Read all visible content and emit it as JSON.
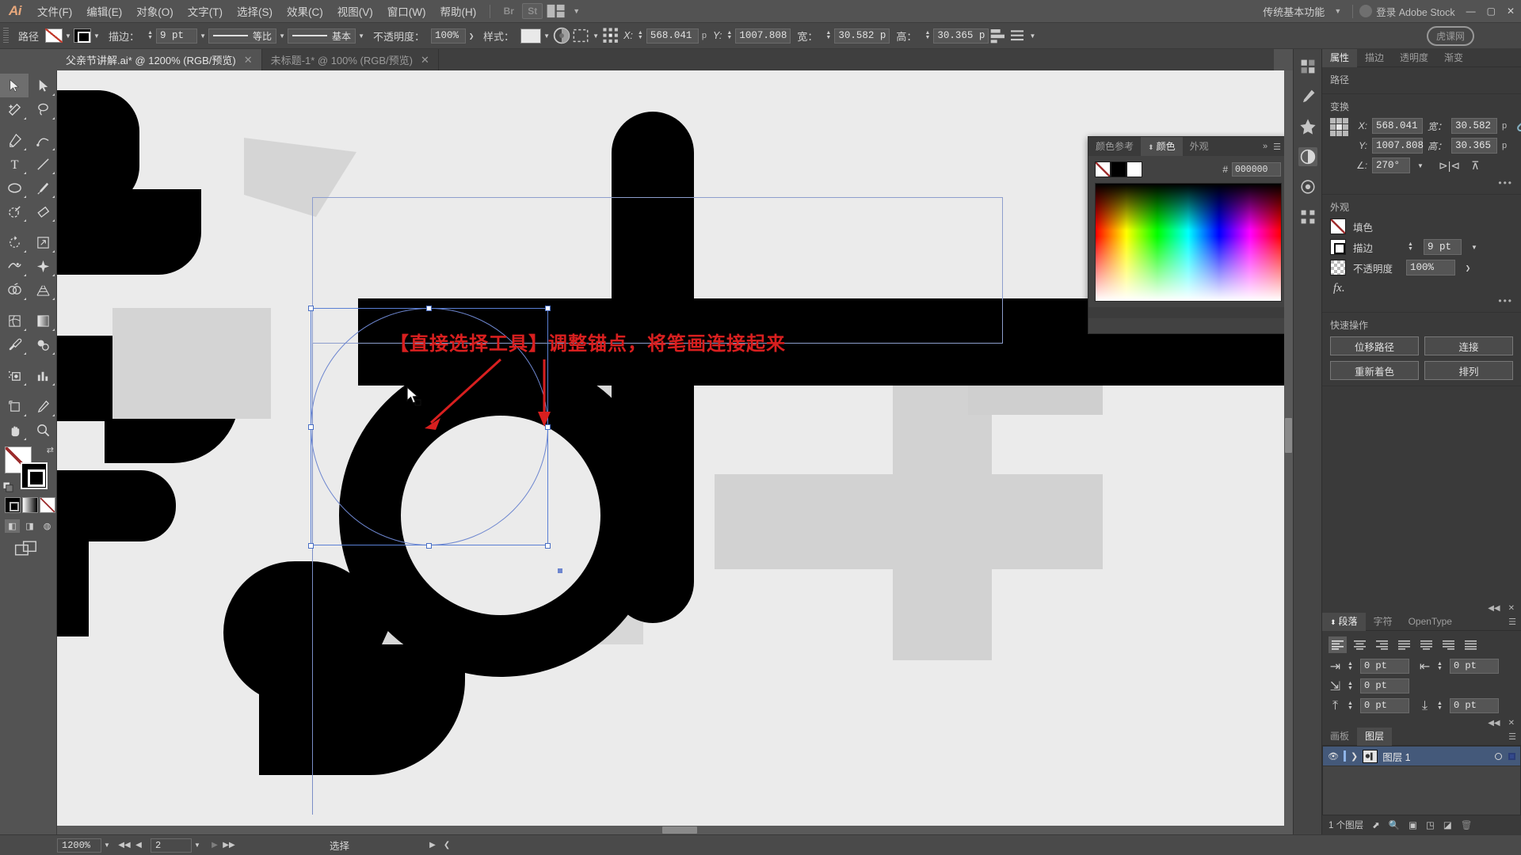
{
  "app": {
    "name": "Ai",
    "title": "Adobe Illustrator"
  },
  "menubar": {
    "items": [
      {
        "label": "文件(F)",
        "name": "menu-file"
      },
      {
        "label": "编辑(E)",
        "name": "menu-edit"
      },
      {
        "label": "对象(O)",
        "name": "menu-object"
      },
      {
        "label": "文字(T)",
        "name": "menu-type"
      },
      {
        "label": "选择(S)",
        "name": "menu-select"
      },
      {
        "label": "效果(C)",
        "name": "menu-effect"
      },
      {
        "label": "视图(V)",
        "name": "menu-view"
      },
      {
        "label": "窗口(W)",
        "name": "menu-window"
      },
      {
        "label": "帮助(H)",
        "name": "menu-help"
      }
    ],
    "bridge_label": "Br",
    "stock_label": "St",
    "arrange_label": "",
    "workspace": "传统基本功能",
    "signin": "登录 Adobe Stock",
    "win_min": "—",
    "win_max": "▢",
    "win_close": "✕"
  },
  "controlbar": {
    "object_label": "路径",
    "stroke_label": "描边：",
    "stroke_weight": "9 pt",
    "stroke_profile": "等比",
    "brush_def": "基本",
    "opacity_label": "不透明度：",
    "opacity_value": "100%",
    "style_label": "样式：",
    "x_label": "X:",
    "x_value": "568.041",
    "x_unit": "p",
    "y_label": "Y:",
    "y_value": "1007.808",
    "w_label": "宽：",
    "w_value": "30.582 p",
    "h_label": "高：",
    "h_value": "30.365 p"
  },
  "tabs": [
    {
      "title": "父亲节讲解.ai* @ 1200% (RGB/预览)",
      "active": true,
      "close": "✕"
    },
    {
      "title": "未标题-1* @ 100% (RGB/预览)",
      "active": false,
      "close": "✕"
    }
  ],
  "toolbar": {
    "tools": [
      {
        "name": "selection-tool",
        "glyph": "selection",
        "selected": true
      },
      {
        "name": "direct-selection-tool",
        "glyph": "direct"
      },
      {
        "name": "magic-wand-tool",
        "glyph": "wand"
      },
      {
        "name": "lasso-tool",
        "glyph": "lasso"
      },
      {
        "name": "pen-tool",
        "glyph": "pen"
      },
      {
        "name": "curvature-tool",
        "glyph": "curv"
      },
      {
        "name": "type-tool",
        "glyph": "type"
      },
      {
        "name": "line-segment-tool",
        "glyph": "line"
      },
      {
        "name": "ellipse-tool",
        "glyph": "ellipse"
      },
      {
        "name": "paintbrush-tool",
        "glyph": "brush"
      },
      {
        "name": "shaper-tool",
        "glyph": "shaper"
      },
      {
        "name": "eraser-tool",
        "glyph": "eraser"
      },
      {
        "name": "rotate-tool",
        "glyph": "rotate"
      },
      {
        "name": "scale-tool",
        "glyph": "scale"
      },
      {
        "name": "width-tool",
        "glyph": "width"
      },
      {
        "name": "free-transform-tool",
        "glyph": "freetr"
      },
      {
        "name": "shape-builder-tool",
        "glyph": "shapebuild"
      },
      {
        "name": "perspective-grid-tool",
        "glyph": "persp"
      },
      {
        "name": "mesh-tool",
        "glyph": "mesh"
      },
      {
        "name": "gradient-tool",
        "glyph": "gradient"
      },
      {
        "name": "eyedropper-tool",
        "glyph": "eyedrop"
      },
      {
        "name": "blend-tool",
        "glyph": "blend"
      },
      {
        "name": "symbol-sprayer-tool",
        "glyph": "symbol"
      },
      {
        "name": "column-graph-tool",
        "glyph": "graph"
      },
      {
        "name": "artboard-tool",
        "glyph": "artboard"
      },
      {
        "name": "slice-tool",
        "glyph": "slice"
      },
      {
        "name": "hand-tool",
        "glyph": "hand"
      },
      {
        "name": "zoom-tool",
        "glyph": "zoom"
      }
    ],
    "fill_color": "#ffffff",
    "stroke_color": "#000000"
  },
  "canvas": {
    "annotation": "【直接选择工具】调整锚点，将笔画连接起来",
    "annotation_color": "#d81f1f",
    "artwork_alt": "大写字母 d 形黑色字体轮廓"
  },
  "color_panel": {
    "tabs": [
      {
        "label": "颜色参考",
        "active": false,
        "name": "tab-color-guide"
      },
      {
        "label": "颜色",
        "active": true,
        "name": "tab-color"
      },
      {
        "label": "外观",
        "active": false,
        "name": "tab-appearance"
      }
    ],
    "expand": "»",
    "menu": "☰",
    "hex_label": "#",
    "hex_value": "000000",
    "swatch_none": "none",
    "swatch_black": "#000000",
    "swatch_white": "#ffffff"
  },
  "properties": {
    "tabs": [
      {
        "label": "属性",
        "active": true,
        "name": "tab-properties"
      },
      {
        "label": "描边",
        "active": false,
        "name": "tab-stroke"
      },
      {
        "label": "透明度",
        "active": false,
        "name": "tab-transparency"
      },
      {
        "label": "渐变",
        "active": false,
        "name": "tab-gradient"
      }
    ],
    "object_type": "路径",
    "transform": {
      "title": "变换",
      "x_label": "X:",
      "x_value": "568.041",
      "y_label": "Y:",
      "y_value": "1007.808",
      "w_label": "宽：",
      "w_value": "30.582",
      "w_unit": "p",
      "h_label": "高：",
      "h_value": "30.365",
      "h_unit": "p",
      "angle_label": "∠:",
      "angle_value": "270°",
      "more": "•••"
    },
    "appearance": {
      "title": "外观",
      "fill_label": "填色",
      "stroke_label": "描边",
      "stroke_value": "9 pt",
      "opacity_label": "不透明度",
      "opacity_value": "100%",
      "fx_label": "fx.",
      "more": "•••"
    },
    "quick_actions": {
      "title": "快速操作",
      "buttons": [
        {
          "label": "位移路径",
          "name": "offset-path-button"
        },
        {
          "label": "连接",
          "name": "join-button"
        },
        {
          "label": "重新着色",
          "name": "recolor-button"
        },
        {
          "label": "排列",
          "name": "arrange-button"
        }
      ]
    }
  },
  "paragraph_panel": {
    "tabs": [
      {
        "label": "段落",
        "active": true,
        "name": "tab-paragraph"
      },
      {
        "label": "字符",
        "active": false,
        "name": "tab-character"
      },
      {
        "label": "OpenType",
        "active": false,
        "name": "tab-opentype"
      }
    ],
    "menu": "☰",
    "collapse": "◀◀",
    "close": "✕",
    "indents": [
      {
        "name": "left-indent",
        "value": "0 pt"
      },
      {
        "name": "right-indent",
        "value": "0 pt"
      },
      {
        "name": "first-line-indent",
        "value": "0 pt"
      },
      {
        "name": "space-before",
        "value": "0 pt"
      },
      {
        "name": "space-after",
        "value": "0 pt"
      }
    ]
  },
  "layers_panel": {
    "tabs": [
      {
        "label": "画板",
        "active": false,
        "name": "tab-artboards"
      },
      {
        "label": "图层",
        "active": true,
        "name": "tab-layers"
      }
    ],
    "menu": "☰",
    "collapse": "◀◀",
    "close": "✕",
    "rows": [
      {
        "name": "图层 1",
        "visible": true,
        "selected": true
      }
    ],
    "footer_count": "1 个图层",
    "footer_icons": [
      "locate-object-icon",
      "search-icon",
      "make-sublayer-icon",
      "make-clipping-mask-icon",
      "new-layer-icon",
      "delete-layer-icon"
    ]
  },
  "statusbar": {
    "zoom": "1200%",
    "page": "2",
    "status_text": "选择",
    "nav_first": "◀◀",
    "nav_prev": "◀",
    "nav_next": "▶",
    "nav_last": "▶▶"
  },
  "watermark": {
    "text": "虎课网"
  }
}
